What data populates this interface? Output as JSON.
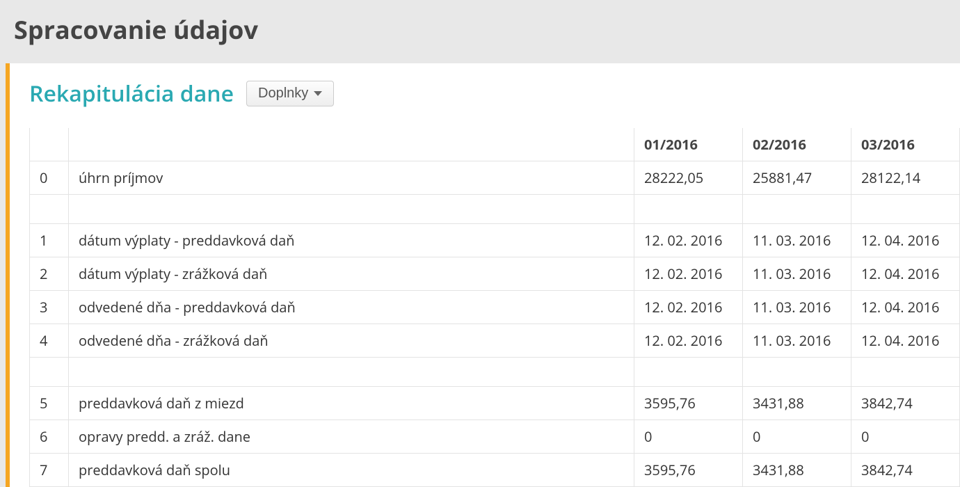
{
  "page": {
    "title": "Spracovanie údajov",
    "section_title": "Rekapitulácia dane",
    "dropdown_label": "Doplnky"
  },
  "columns": [
    "01/2016",
    "02/2016",
    "03/2016"
  ],
  "groups": [
    {
      "rows": [
        {
          "idx": "0",
          "label": "úhrn príjmov",
          "v": [
            "28222,05",
            "25881,47",
            "28122,14"
          ]
        }
      ]
    },
    {
      "rows": [
        {
          "idx": "1",
          "label": "dátum výplaty - preddavková daň",
          "v": [
            "12. 02. 2016",
            "11. 03. 2016",
            "12. 04. 2016"
          ]
        },
        {
          "idx": "2",
          "label": "dátum výplaty - zrážková daň",
          "v": [
            "12. 02. 2016",
            "11. 03. 2016",
            "12. 04. 2016"
          ]
        },
        {
          "idx": "3",
          "label": "odvedené dňa - preddavková daň",
          "v": [
            "12. 02. 2016",
            "11. 03. 2016",
            "12. 04. 2016"
          ]
        },
        {
          "idx": "4",
          "label": "odvedené dňa - zrážková daň",
          "v": [
            "12. 02. 2016",
            "11. 03. 2016",
            "12. 04. 2016"
          ]
        }
      ]
    },
    {
      "rows": [
        {
          "idx": "5",
          "label": "preddavková daň z miezd",
          "v": [
            "3595,76",
            "3431,88",
            "3842,74"
          ]
        },
        {
          "idx": "6",
          "label": "opravy predd. a zráž. dane",
          "v": [
            "0",
            "0",
            "0"
          ]
        },
        {
          "idx": "7",
          "label": "preddavková daň spolu",
          "v": [
            "3595,76",
            "3431,88",
            "3842,74"
          ]
        }
      ]
    }
  ]
}
